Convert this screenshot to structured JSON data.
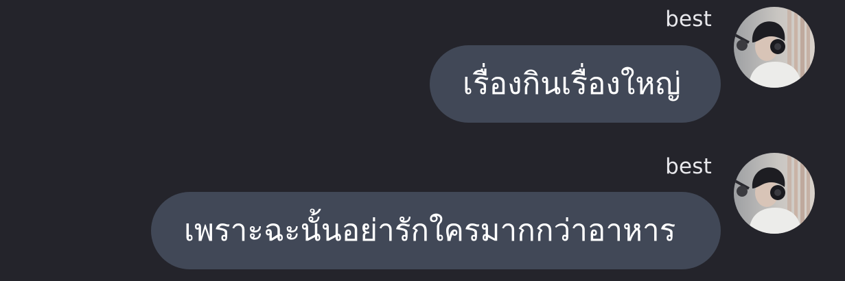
{
  "chat": {
    "messages": [
      {
        "sender": "best",
        "text": "เรื่องกินเรื่องใหญ่",
        "avatar_icon": "user-photo-avatar"
      },
      {
        "sender": "best",
        "text": "เพราะฉะนั้นอย่ารักใครมากกว่าอาหาร",
        "avatar_icon": "user-photo-avatar"
      }
    ]
  },
  "colors": {
    "background": "#24242b",
    "bubble": "#414857",
    "text": "#ffffff",
    "sender": "#e8e8ec"
  }
}
